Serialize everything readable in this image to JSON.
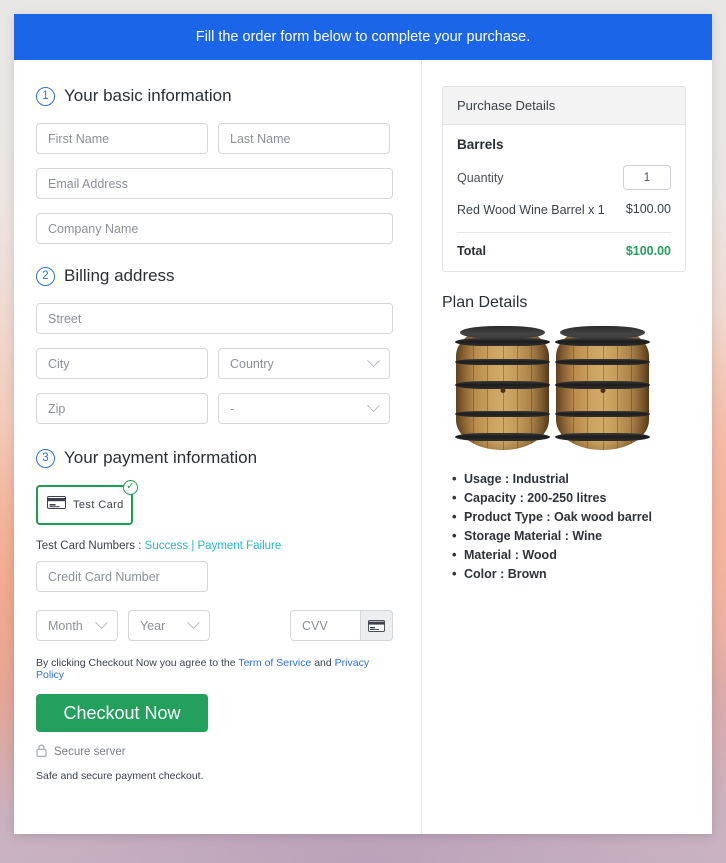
{
  "banner": {
    "text": "Fill the order form below to complete your purchase."
  },
  "section1": {
    "number": "1",
    "title": "Your basic information",
    "fields": {
      "first_name": "First Name",
      "last_name": "Last Name",
      "email": "Email Address",
      "company": "Company Name"
    }
  },
  "section2": {
    "number": "2",
    "title": "Billing address",
    "fields": {
      "street": "Street",
      "city": "City",
      "country": "Country",
      "zip": "Zip",
      "state": "-"
    }
  },
  "section3": {
    "number": "3",
    "title": "Your payment information",
    "pay_method": {
      "label": "Test Card",
      "icon": "credit-card-icon",
      "selected_badge": "✓"
    },
    "test_cards": {
      "prefix": "Test Card Numbers : ",
      "success": "Success",
      "separator": " | ",
      "failure": "Payment Failure"
    },
    "fields": {
      "card_number": "Credit Card Number",
      "month": "Month",
      "year": "Year",
      "cvv": "CVV"
    },
    "terms": {
      "prefix": "By clicking Checkout Now you agree to the ",
      "tos": "Term of Service",
      "middle": " and ",
      "privacy": "Privacy Policy"
    },
    "checkout_label": "Checkout Now",
    "secure_server": "Secure server",
    "safe_note": "Safe and secure payment checkout."
  },
  "purchase": {
    "header": "Purchase Details",
    "group_title": "Barrels",
    "quantity_label": "Quantity",
    "quantity_value": "1",
    "item_name": "Red Wood Wine Barrel x 1",
    "item_price": "$100.00",
    "total_label": "Total",
    "total_value": "$100.00"
  },
  "plan": {
    "title": "Plan Details",
    "image": "two-wooden-barrels-image",
    "specs": [
      "Usage : Industrial",
      "Capacity : 200-250 litres",
      "Product Type : Oak wood barrel",
      "Storage Material : Wine",
      "Material : Wood",
      "Color : Brown"
    ]
  },
  "colors": {
    "banner_blue": "#1b66e8",
    "accent_blue": "#2f72d8",
    "success_green": "#23a05c",
    "select_green": "#1f9d55",
    "link_teal": "#29b6c7"
  }
}
